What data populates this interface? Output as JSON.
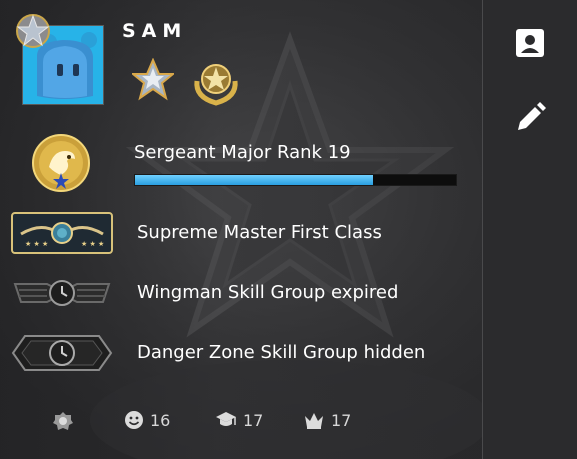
{
  "profile": {
    "username": "SAM",
    "avatar_icon": "blue-bear-avatar-icon"
  },
  "rank": {
    "label": "Sergeant Major Rank 19",
    "progress_fraction": 0.74,
    "medal_icon": "eagle-rank-medal-icon"
  },
  "skill_groups": {
    "competitive": "Supreme Master First Class",
    "wingman": "Wingman Skill Group expired",
    "danger_zone": "Danger Zone Skill Group hidden"
  },
  "commendations": {
    "service_medal_icon": "service-medal-icon",
    "friendly": "16",
    "teacher": "17",
    "leader": "17"
  },
  "sidebar": {
    "profile_icon": "profile-card-icon",
    "edit_icon": "pencil-edit-icon"
  },
  "colors": {
    "accent_blue": "#2a9fe0",
    "avatar_bg": "#27b3e8",
    "gold": "#d9b24a"
  }
}
